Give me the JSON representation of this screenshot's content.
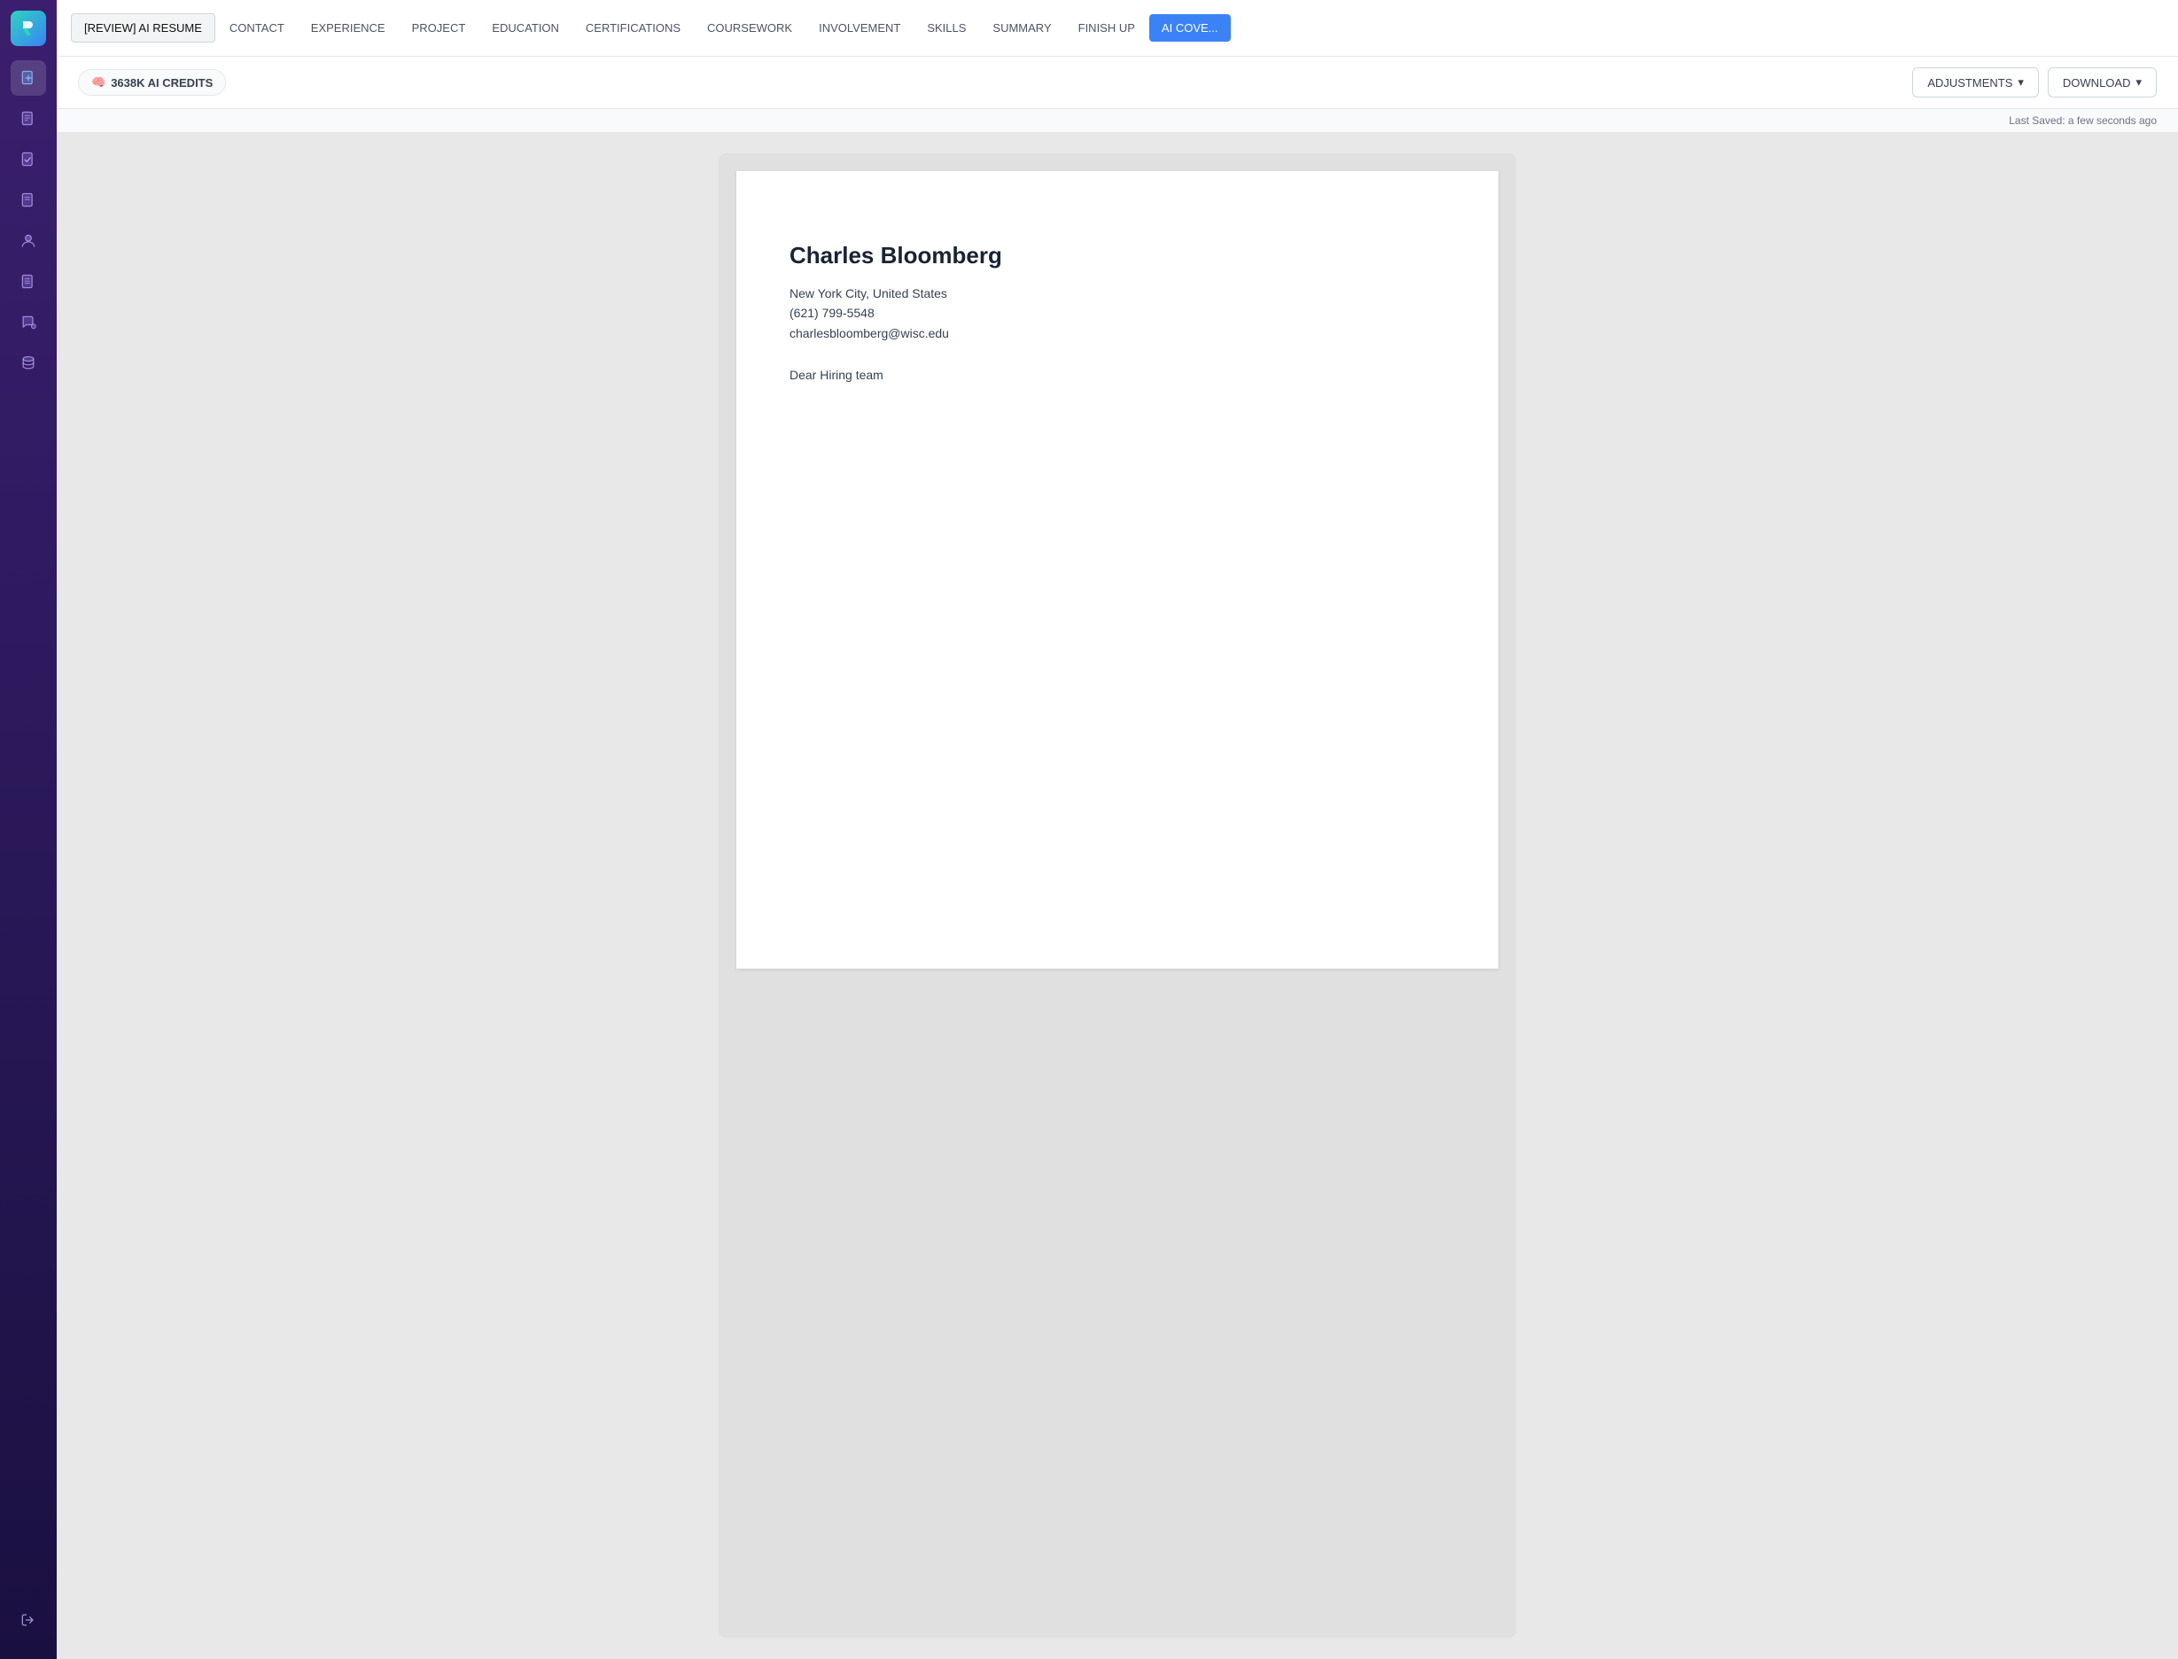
{
  "sidebar": {
    "logo_alt": "R logo",
    "icons": [
      {
        "name": "new-document-icon",
        "symbol": "➕",
        "label": "New Document"
      },
      {
        "name": "document-icon-1",
        "symbol": "📄",
        "label": "Document"
      },
      {
        "name": "document-check-icon",
        "symbol": "✅",
        "label": "Document Check"
      },
      {
        "name": "document-icon-2",
        "symbol": "📋",
        "label": "Document 2"
      },
      {
        "name": "person-icon",
        "symbol": "👤",
        "label": "Person"
      },
      {
        "name": "list-icon",
        "symbol": "📝",
        "label": "List"
      },
      {
        "name": "chat-icon",
        "symbol": "💬",
        "label": "Chat"
      },
      {
        "name": "database-icon",
        "symbol": "🗄️",
        "label": "Database"
      }
    ],
    "bottom_icons": [
      {
        "name": "logout-icon",
        "symbol": "➡",
        "label": "Logout"
      }
    ]
  },
  "nav": {
    "items": [
      {
        "label": "[REVIEW] AI RESUME",
        "key": "review-ai-resume",
        "active": true
      },
      {
        "label": "CONTACT",
        "key": "contact"
      },
      {
        "label": "EXPERIENCE",
        "key": "experience"
      },
      {
        "label": "PROJECT",
        "key": "project"
      },
      {
        "label": "EDUCATION",
        "key": "education"
      },
      {
        "label": "CERTIFICATIONS",
        "key": "certifications"
      },
      {
        "label": "COURSEWORK",
        "key": "coursework"
      },
      {
        "label": "INVOLVEMENT",
        "key": "involvement"
      },
      {
        "label": "SKILLS",
        "key": "skills"
      },
      {
        "label": "SUMMARY",
        "key": "summary"
      },
      {
        "label": "FINISH UP",
        "key": "finish-up"
      },
      {
        "label": "AI COVE...",
        "key": "ai-cover",
        "highlight": true
      }
    ]
  },
  "toolbar": {
    "credits_icon": "🧠",
    "credits_label": "3638K AI CREDITS",
    "adjustments_label": "ADJUSTMENTS",
    "download_label": "DOWNLOAD",
    "chevron": "▾"
  },
  "save_status": {
    "label": "Last Saved: a few seconds ago"
  },
  "document": {
    "name": "Charles Bloomberg",
    "address": "New York City, United States",
    "phone": "(621) 799-5548",
    "email": "charlesbloomberg@wisc.edu",
    "greeting": "Dear Hiring team"
  }
}
